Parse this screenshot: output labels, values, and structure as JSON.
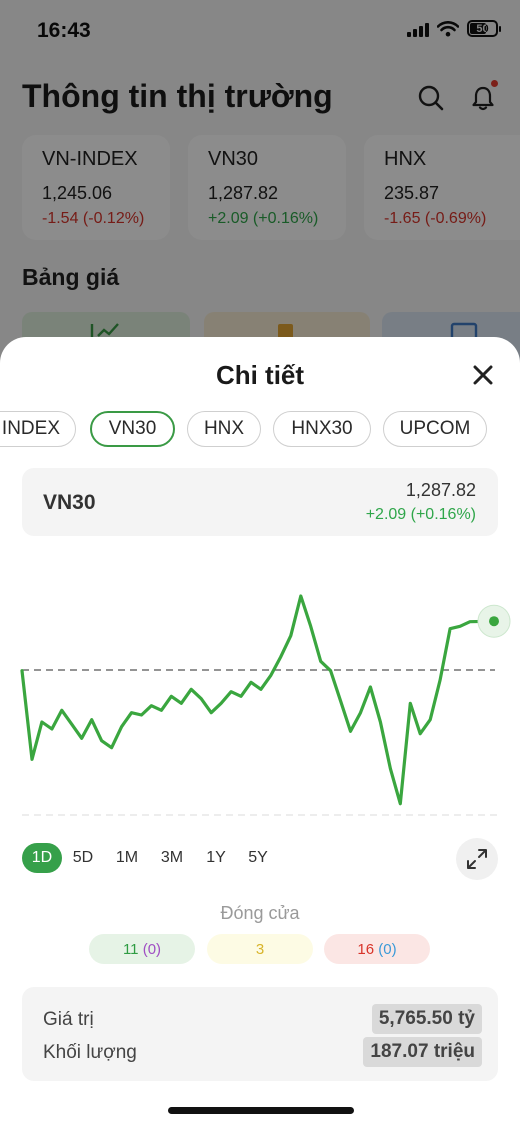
{
  "status_bar": {
    "time": "16:43",
    "battery": "50"
  },
  "background": {
    "title": "Thông tin thị trường",
    "indices": [
      {
        "name": "VN-INDEX",
        "value": "1,245.06",
        "change": "-1.54 (-0.12%)",
        "direction": "down"
      },
      {
        "name": "VN30",
        "value": "1,287.82",
        "change": "+2.09 (+0.16%)",
        "direction": "up"
      },
      {
        "name": "HNX",
        "value": "235.87",
        "change": "-1.65 (-0.69%)",
        "direction": "down"
      }
    ],
    "section_title": "Bảng giá"
  },
  "sheet": {
    "title": "Chi tiết",
    "tabs": [
      "INDEX",
      "VN30",
      "HNX",
      "HNX30",
      "UPCOM"
    ],
    "active_tab": "VN30",
    "selected": {
      "name": "VN30",
      "value": "1,287.82",
      "change": "+2.09 (+0.16%)"
    },
    "ranges": [
      "1D",
      "5D",
      "1M",
      "3M",
      "1Y",
      "5Y"
    ],
    "active_range": "1D",
    "close_label": "Đóng cửa",
    "breadth": {
      "up": "11",
      "up_ceiling": "(0)",
      "unchanged": "3",
      "down": "16",
      "down_floor": "(0)"
    },
    "stats": [
      {
        "label": "Giá trị",
        "value": "5,765.50 tỷ"
      },
      {
        "label": "Khối lượng",
        "value": "187.07 triệu"
      }
    ]
  },
  "chart_data": {
    "type": "line",
    "reference": 1285.73,
    "last": 1287.82,
    "ylim": [
      1279,
      1291
    ],
    "series": [
      {
        "color": "#3aa63f",
        "values": [
          1285.7,
          1281.9,
          1283.5,
          1283.2,
          1284.0,
          1283.4,
          1282.8,
          1283.6,
          1282.7,
          1282.4,
          1283.3,
          1283.9,
          1283.8,
          1284.2,
          1284.0,
          1284.6,
          1284.3,
          1284.9,
          1284.5,
          1283.9,
          1284.3,
          1284.8,
          1284.6,
          1285.2,
          1284.9,
          1285.5,
          1286.3,
          1287.2,
          1288.9,
          1287.6,
          1286.1,
          1285.7,
          1284.4,
          1283.1,
          1283.9,
          1285.0,
          1283.5,
          1281.5,
          1280.0,
          1284.3,
          1283.0,
          1283.6,
          1285.3,
          1287.5,
          1287.6,
          1287.8,
          1287.82
        ]
      }
    ]
  },
  "colors": {
    "accent": "#36a04a",
    "up": "#2fa64a",
    "down": "#d8342a"
  }
}
